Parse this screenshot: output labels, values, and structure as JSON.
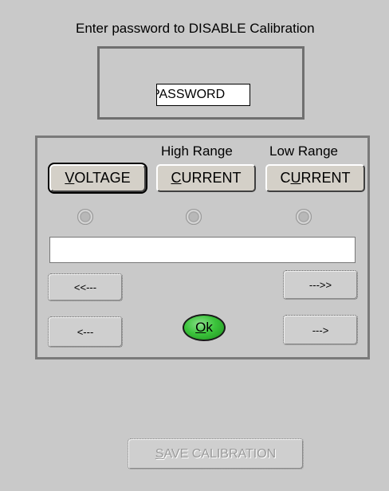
{
  "prompt": "Enter password to DISABLE Calibration",
  "password_field": {
    "value": "PASSWORD"
  },
  "ranges": {
    "high_label": "High Range",
    "low_label": "Low Range"
  },
  "buttons": {
    "voltage": {
      "mn": "V",
      "rest": "OLTAGE"
    },
    "high_current": {
      "mn": "C",
      "rest": "URRENT"
    },
    "low_current": {
      "pre": "C",
      "mn": "U",
      "rest": "RRENT"
    },
    "fast_back": "<<---",
    "fast_forward": "--->>",
    "back": "<---",
    "forward": "--->",
    "ok": {
      "mn": "O",
      "rest": "k"
    },
    "save": {
      "mn": "S",
      "rest": "AVE CALIBRATION"
    }
  },
  "status_field": {
    "value": ""
  }
}
